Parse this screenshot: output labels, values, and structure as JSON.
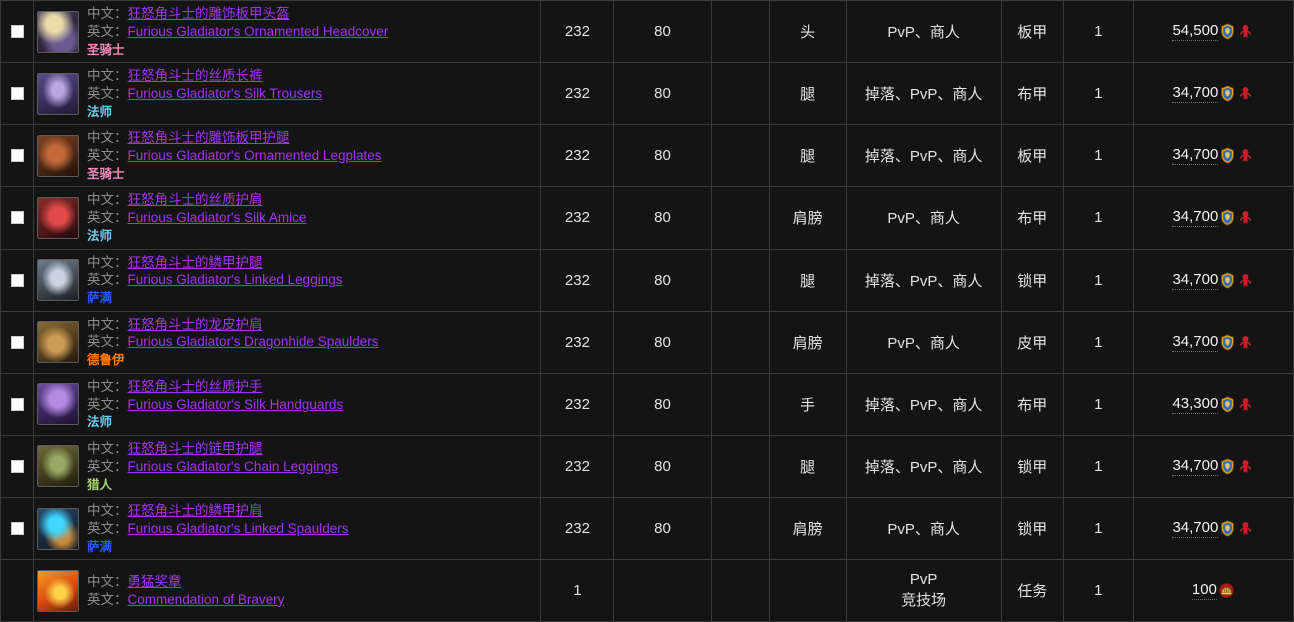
{
  "labels": {
    "zh": "中文：",
    "en": "英文："
  },
  "colors": {
    "epic": "#a335ee",
    "paladin": "#f58cba",
    "mage": "#69ccf0",
    "shaman": "#2459ff",
    "druid": "#ff7d0a",
    "hunter": "#abd473",
    "background": "#141414",
    "border": "#3a3a3a",
    "text": "#d8d8d8",
    "label": "#8c8c8c"
  },
  "rows": [
    {
      "checkbox": "unchecked",
      "icon": "plate-helm-icon",
      "name_zh": "狂怒角斗士的雕饰板甲头盔",
      "name_en": "Furious Gladiator's Ornamented Headcover",
      "class_zh": "圣骑士",
      "item_level": "232",
      "req_level": "80",
      "blank": "",
      "slot": "头",
      "source": "PvP、商人",
      "armor": "板甲",
      "quantity": "1",
      "cost": "54,500",
      "cost_icons": [
        "alliance-icon",
        "horde-icon"
      ]
    },
    {
      "checkbox": "unchecked",
      "icon": "silk-trousers-icon",
      "name_zh": "狂怒角斗士的丝质长裤",
      "name_en": "Furious Gladiator's Silk Trousers",
      "class_zh": "法师",
      "item_level": "232",
      "req_level": "80",
      "blank": "",
      "slot": "腿",
      "source": "掉落、PvP、商人",
      "armor": "布甲",
      "quantity": "1",
      "cost": "34,700",
      "cost_icons": [
        "alliance-icon",
        "horde-icon"
      ]
    },
    {
      "checkbox": "unchecked",
      "icon": "plate-legplates-icon",
      "name_zh": "狂怒角斗士的雕饰板甲护腿",
      "name_en": "Furious Gladiator's Ornamented Legplates",
      "class_zh": "圣骑士",
      "item_level": "232",
      "req_level": "80",
      "blank": "",
      "slot": "腿",
      "source": "掉落、PvP、商人",
      "armor": "板甲",
      "quantity": "1",
      "cost": "34,700",
      "cost_icons": [
        "alliance-icon",
        "horde-icon"
      ]
    },
    {
      "checkbox": "unchecked",
      "icon": "silk-amice-icon",
      "name_zh": "狂怒角斗士的丝质护肩",
      "name_en": "Furious Gladiator's Silk Amice",
      "class_zh": "法师",
      "item_level": "232",
      "req_level": "80",
      "blank": "",
      "slot": "肩膀",
      "source": "PvP、商人",
      "armor": "布甲",
      "quantity": "1",
      "cost": "34,700",
      "cost_icons": [
        "alliance-icon",
        "horde-icon"
      ]
    },
    {
      "checkbox": "unchecked",
      "icon": "linked-leggings-icon",
      "name_zh": "狂怒角斗士的鳞甲护腿",
      "name_en": "Furious Gladiator's Linked Leggings",
      "class_zh": "萨满",
      "item_level": "232",
      "req_level": "80",
      "blank": "",
      "slot": "腿",
      "source": "掉落、PvP、商人",
      "armor": "锁甲",
      "quantity": "1",
      "cost": "34,700",
      "cost_icons": [
        "alliance-icon",
        "horde-icon"
      ]
    },
    {
      "checkbox": "unchecked",
      "icon": "dragonhide-spaulders-icon",
      "name_zh": "狂怒角斗士的龙皮护肩",
      "name_en": "Furious Gladiator's Dragonhide Spaulders",
      "class_zh": "德鲁伊",
      "item_level": "232",
      "req_level": "80",
      "blank": "",
      "slot": "肩膀",
      "source": "PvP、商人",
      "armor": "皮甲",
      "quantity": "1",
      "cost": "34,700",
      "cost_icons": [
        "alliance-icon",
        "horde-icon"
      ]
    },
    {
      "checkbox": "unchecked",
      "icon": "silk-handguards-icon",
      "name_zh": "狂怒角斗士的丝质护手",
      "name_en": "Furious Gladiator's Silk Handguards",
      "class_zh": "法师",
      "item_level": "232",
      "req_level": "80",
      "blank": "",
      "slot": "手",
      "source": "掉落、PvP、商人",
      "armor": "布甲",
      "quantity": "1",
      "cost": "43,300",
      "cost_icons": [
        "alliance-icon",
        "horde-icon"
      ]
    },
    {
      "checkbox": "unchecked",
      "icon": "chain-leggings-icon",
      "name_zh": "狂怒角斗士的链甲护腿",
      "name_en": "Furious Gladiator's Chain Leggings",
      "class_zh": "猎人",
      "item_level": "232",
      "req_level": "80",
      "blank": "",
      "slot": "腿",
      "source": "掉落、PvP、商人",
      "armor": "锁甲",
      "quantity": "1",
      "cost": "34,700",
      "cost_icons": [
        "alliance-icon",
        "horde-icon"
      ]
    },
    {
      "checkbox": "unchecked",
      "icon": "linked-spaulders-icon",
      "name_zh": "狂怒角斗士的鳞甲护肩",
      "name_en": "Furious Gladiator's Linked Spaulders",
      "class_zh": "萨满",
      "item_level": "232",
      "req_level": "80",
      "blank": "",
      "slot": "肩膀",
      "source": "PvP、商人",
      "armor": "锁甲",
      "quantity": "1",
      "cost": "34,700",
      "cost_icons": [
        "alliance-icon",
        "horde-icon"
      ]
    },
    {
      "checkbox": "none",
      "icon": "commendation-icon",
      "name_zh": "勇猛奖章",
      "name_en": "Commendation of Bravery",
      "class_zh": "",
      "item_level": "1",
      "req_level": "",
      "blank": "",
      "slot": "",
      "source": "PvP\n竞技场",
      "armor": "任务",
      "quantity": "1",
      "cost": "100",
      "cost_icons": [
        "arena-points-icon"
      ]
    }
  ]
}
